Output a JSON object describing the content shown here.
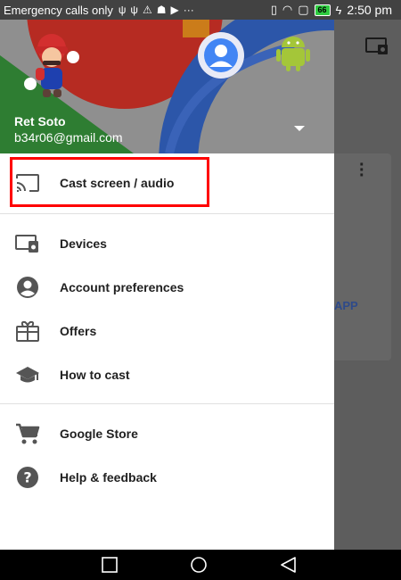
{
  "status_bar": {
    "carrier_text": "Emergency calls only",
    "icons": [
      "usb-icon",
      "usb-icon",
      "warning-icon",
      "android-debug-icon",
      "play-icon",
      "more-icon"
    ],
    "battery_level": "66",
    "time": "2:50 pm"
  },
  "drawer": {
    "user_name": "Ret Soto",
    "user_email": "b34r06@gmail.com",
    "menu": [
      {
        "label": "Cast screen / audio",
        "icon": "cast-icon"
      },
      {
        "label": "Devices",
        "icon": "devices-icon"
      },
      {
        "label": "Account preferences",
        "icon": "account-circle-icon"
      },
      {
        "label": "Offers",
        "icon": "gift-icon"
      },
      {
        "label": "How to cast",
        "icon": "school-icon"
      },
      {
        "label": "Google Store",
        "icon": "cart-icon"
      },
      {
        "label": "Help & feedback",
        "icon": "help-icon"
      }
    ]
  },
  "background_app": {
    "button_text": "APP"
  },
  "colors": {
    "highlight": "#ff0000",
    "header_red": "#b62b22",
    "header_blue": "#2c56a9",
    "header_green": "#2e7d32"
  }
}
